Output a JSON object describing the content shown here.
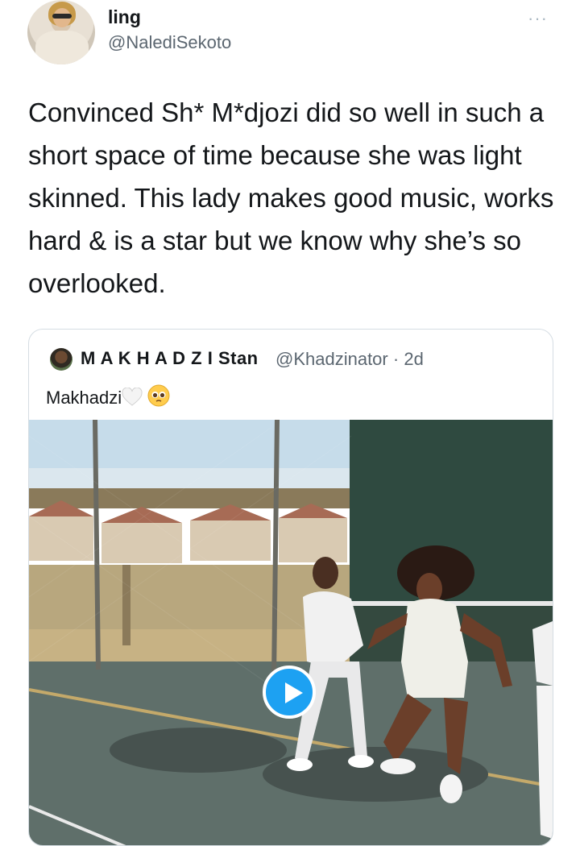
{
  "tweet": {
    "display_name": "ling",
    "handle": "@NalediSekoto",
    "more_icon": "···",
    "text": "Convinced Sh* M*djozi did so well in such a short space of time because she was light skinned. This lady makes good music, works hard & is a star but we know why she’s so overlooked."
  },
  "quoted_tweet": {
    "display_name": "M A K H A D Z I Stan",
    "handle": "@Khadzinator",
    "separator": "·",
    "age": "2d",
    "text": "Makhadzi",
    "emoji_1": "heart-icon",
    "emoji_2": "pleading-face-icon"
  },
  "media": {
    "type": "video",
    "play_icon": "play-icon",
    "colors": {
      "sky": "#c6dcea",
      "court": "#5f6f6a",
      "wall": "#2f4a40",
      "play_accent": "#1da1f2"
    }
  }
}
